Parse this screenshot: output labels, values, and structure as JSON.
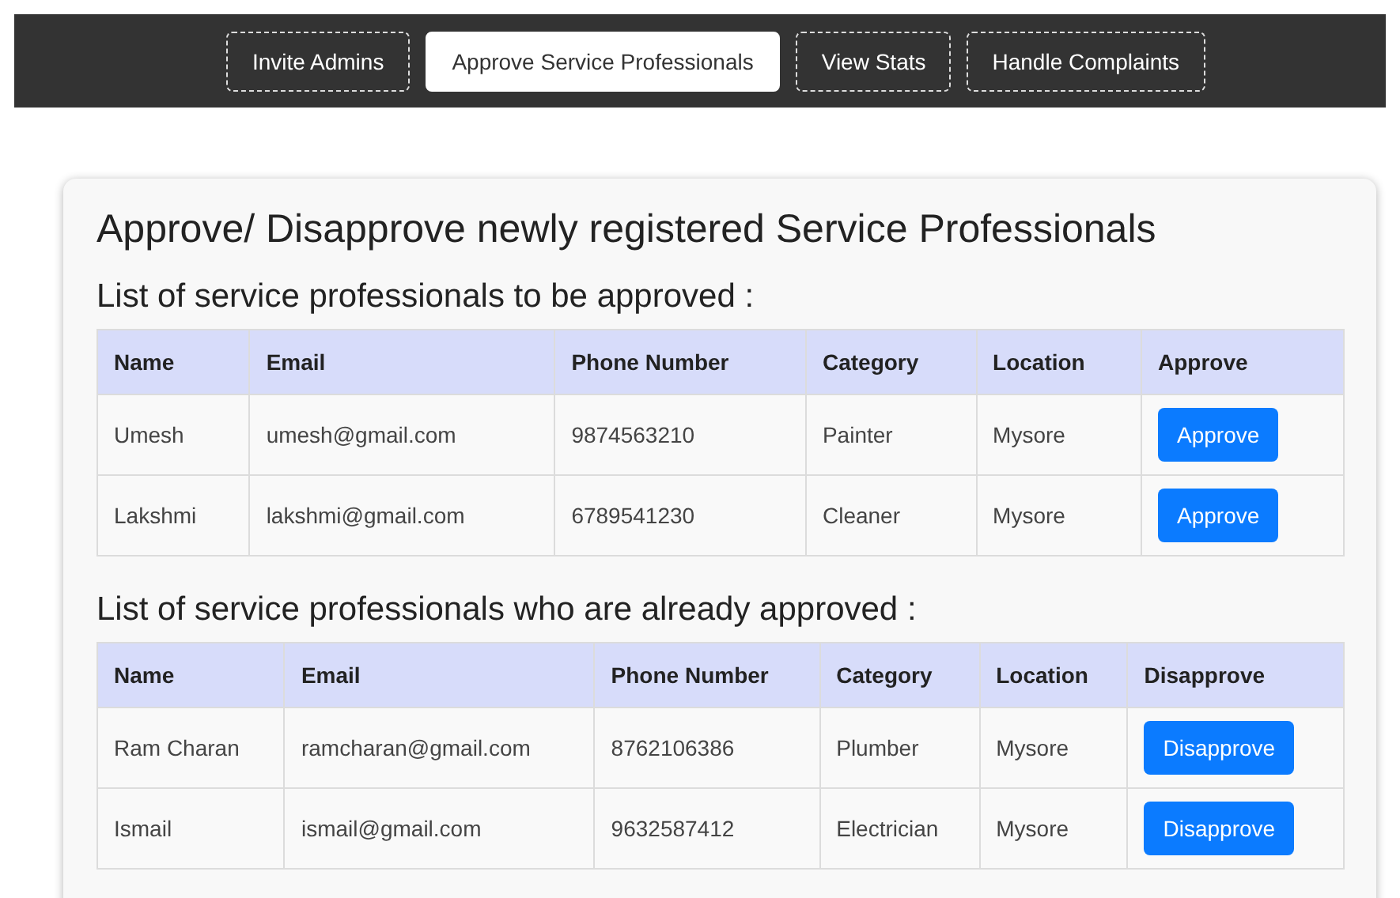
{
  "nav": {
    "tabs": [
      {
        "label": "Invite Admins",
        "selected": false
      },
      {
        "label": "Approve Service Professionals",
        "selected": true
      },
      {
        "label": "View Stats",
        "selected": false
      },
      {
        "label": "Handle Complaints",
        "selected": false
      }
    ]
  },
  "card": {
    "title": "Approve/ Disapprove newly registered Service Professionals",
    "sections": [
      {
        "heading": "List of service professionals to be approved :",
        "columns": [
          "Name",
          "Email",
          "Phone Number",
          "Category",
          "Location",
          "Approve"
        ],
        "rows": [
          {
            "cells": [
              "Umesh",
              "umesh@gmail.com",
              "9874563210",
              "Painter",
              "Mysore"
            ],
            "action": "Approve"
          },
          {
            "cells": [
              "Lakshmi",
              "lakshmi@gmail.com",
              "6789541230",
              "Cleaner",
              "Mysore"
            ],
            "action": "Approve"
          }
        ]
      },
      {
        "heading": "List of service professionals who are already approved :",
        "columns": [
          "Name",
          "Email",
          "Phone Number",
          "Category",
          "Location",
          "Disapprove"
        ],
        "rows": [
          {
            "cells": [
              "Ram Charan",
              "ramcharan@gmail.com",
              "8762106386",
              "Plumber",
              "Mysore"
            ],
            "action": "Disapprove"
          },
          {
            "cells": [
              "Ismail",
              "ismail@gmail.com",
              "9632587412",
              "Electrician",
              "Mysore"
            ],
            "action": "Disapprove"
          }
        ]
      }
    ]
  }
}
